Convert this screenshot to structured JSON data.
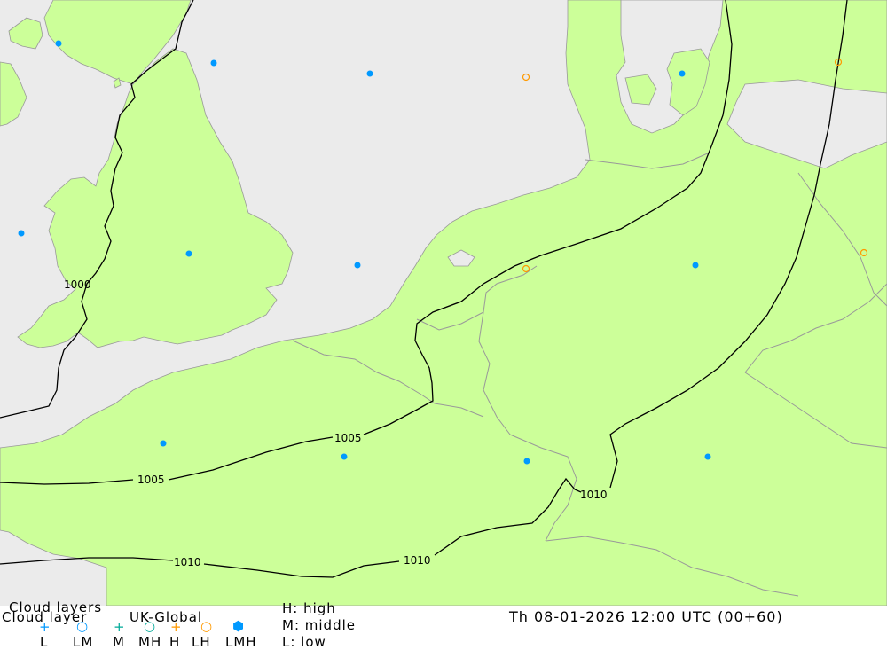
{
  "map": {
    "colors": {
      "sea": "#ebebeb",
      "land": "#ccff99",
      "border": "#999999",
      "isobar": "#000000",
      "marker_lmh": "#0099ff",
      "marker_lh": "#ff9900"
    },
    "isobar_labels": [
      "1000",
      "1005",
      "1005",
      "1010",
      "1010",
      "1010"
    ],
    "markers": [
      {
        "type": "LMH",
        "icon": "filled-dot"
      },
      {
        "type": "LH",
        "icon": "open-circle"
      }
    ]
  },
  "legend": {
    "title": "Cloud layers",
    "subtitle": "Cloud layer",
    "model": "UK-Global",
    "symbols": [
      {
        "code": "L",
        "icon": "plus-icon",
        "color": "#0099ff"
      },
      {
        "code": "LM",
        "icon": "open-circle-icon",
        "color": "#0099ff"
      },
      {
        "code": "M",
        "icon": "plus-icon",
        "color": "#00aa99"
      },
      {
        "code": "MH",
        "icon": "open-circle-icon",
        "color": "#00aa99"
      },
      {
        "code": "H",
        "icon": "plus-icon",
        "color": "#ff9900"
      },
      {
        "code": "LH",
        "icon": "open-circle-icon",
        "color": "#ff9900"
      },
      {
        "code": "LMH",
        "icon": "filled-hexagon-icon",
        "color": "#0099ff"
      }
    ],
    "levels": {
      "high": "H: high",
      "middle": "M: middle",
      "low": "L: low"
    }
  },
  "datetime": "Th 08-01-2026 12:00 UTC (00+60)"
}
